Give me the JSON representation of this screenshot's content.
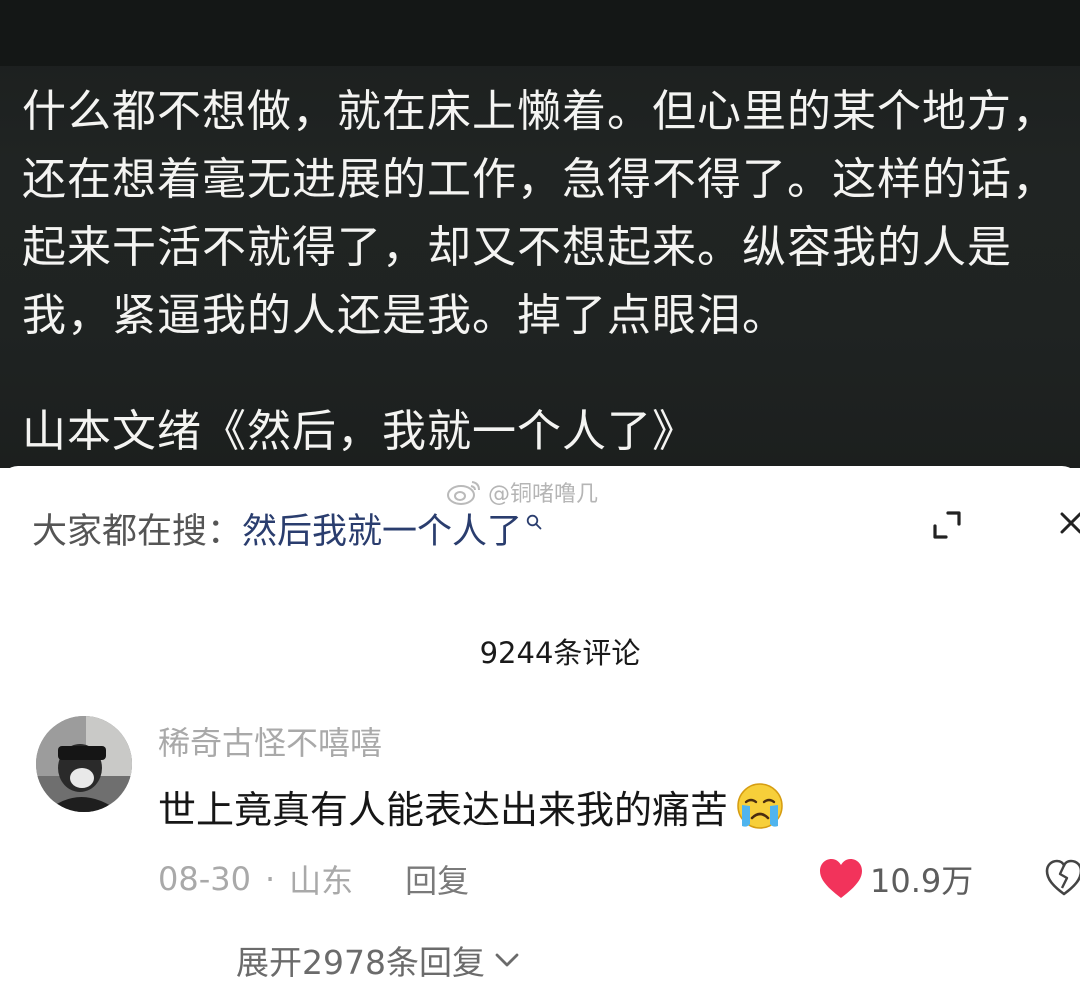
{
  "video": {
    "quote_lines": [
      "什么都不想做，就在床上懒着。但心里的某个地方，",
      "还在想着毫无进展的工作，急得不得了。这样的话，",
      "起来干活不就得了，却又不想起来。纵容我的人是",
      "我，紧逼我的人还是我。掉了点眼泪。"
    ],
    "source": "山本文绪《然后，我就一个人了》"
  },
  "watermark": {
    "text": "@铜啫噜几"
  },
  "search": {
    "prefix": "大家都在搜：",
    "term": "然后我就一个人了"
  },
  "comments": {
    "count_label": "9244条评论",
    "items": [
      {
        "username": "稀奇古怪不嘻嘻",
        "text": "世上竟真有人能表达出来我的痛苦",
        "emoji": "crying-face-icon",
        "date": "08-30",
        "separator": "·",
        "location": "山东",
        "reply_label": "回复",
        "likes": "10.9万",
        "expand_replies_label": "展开2978条回复"
      }
    ]
  },
  "colors": {
    "video_bg": "#1f2322",
    "heart": "#f2335b",
    "search_term": "#2a3d6e"
  }
}
